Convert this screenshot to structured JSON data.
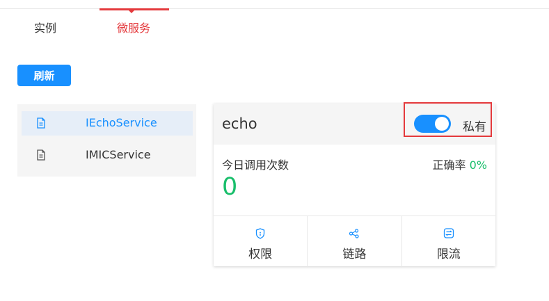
{
  "tabs": [
    {
      "label": "实例",
      "active": false
    },
    {
      "label": "微服务",
      "active": true
    }
  ],
  "toolbar": {
    "refresh_label": "刷新"
  },
  "services": [
    {
      "name": "IEchoService",
      "selected": true,
      "icon": "document-icon"
    },
    {
      "name": "IMICService",
      "selected": false,
      "icon": "document-icon"
    }
  ],
  "card": {
    "title": "echo",
    "toggle": {
      "on": true,
      "label": "私有"
    },
    "calls_label": "今日调用次数",
    "calls_value": "0",
    "accuracy_label": "正确率",
    "accuracy_value": "0%",
    "actions": [
      {
        "label": "权限",
        "icon": "shield-icon"
      },
      {
        "label": "链路",
        "icon": "link-graph-icon"
      },
      {
        "label": "限流",
        "icon": "rate-limit-icon"
      }
    ]
  },
  "colors": {
    "accent": "#1890ff",
    "active_tab": "#e4393c",
    "success": "#19be6b"
  }
}
